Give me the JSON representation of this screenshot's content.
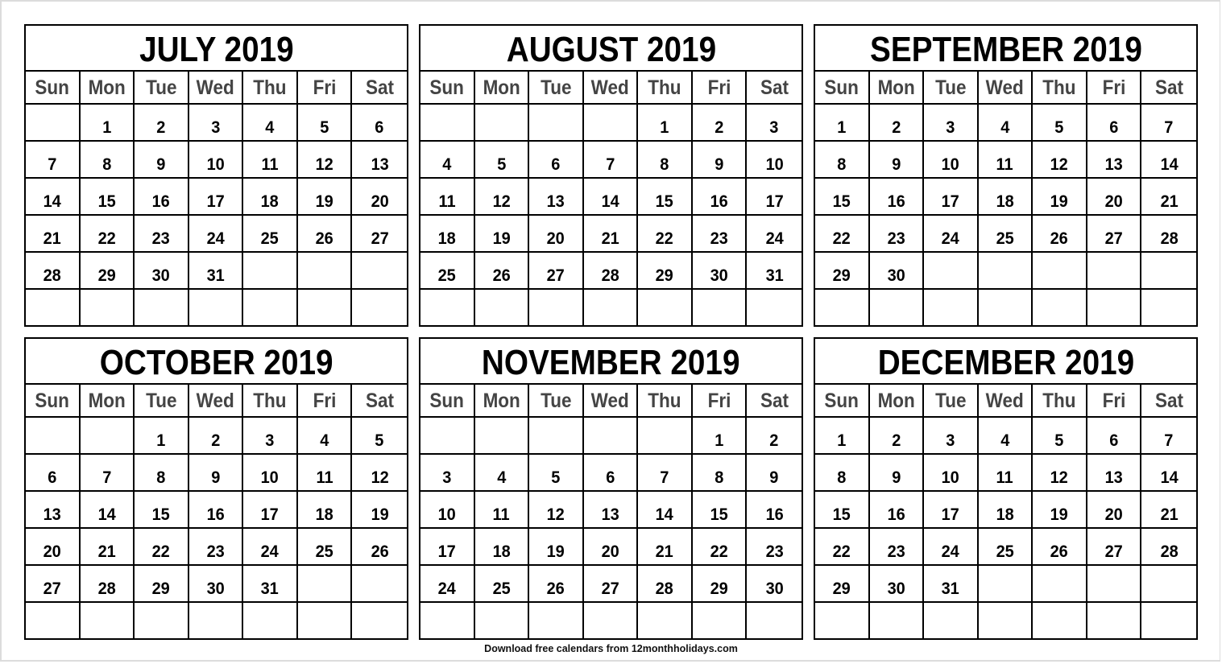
{
  "weekdays": [
    "Sun",
    "Mon",
    "Tue",
    "Wed",
    "Thu",
    "Fri",
    "Sat"
  ],
  "months": [
    {
      "title": "JULY 2019",
      "weeks": [
        [
          "",
          "1",
          "2",
          "3",
          "4",
          "5",
          "6"
        ],
        [
          "7",
          "8",
          "9",
          "10",
          "11",
          "12",
          "13"
        ],
        [
          "14",
          "15",
          "16",
          "17",
          "18",
          "19",
          "20"
        ],
        [
          "21",
          "22",
          "23",
          "24",
          "25",
          "26",
          "27"
        ],
        [
          "28",
          "29",
          "30",
          "31",
          "",
          "",
          ""
        ],
        [
          "",
          "",
          "",
          "",
          "",
          "",
          ""
        ]
      ]
    },
    {
      "title": "AUGUST 2019",
      "weeks": [
        [
          "",
          "",
          "",
          "",
          "1",
          "2",
          "3"
        ],
        [
          "4",
          "5",
          "6",
          "7",
          "8",
          "9",
          "10"
        ],
        [
          "11",
          "12",
          "13",
          "14",
          "15",
          "16",
          "17"
        ],
        [
          "18",
          "19",
          "20",
          "21",
          "22",
          "23",
          "24"
        ],
        [
          "25",
          "26",
          "27",
          "28",
          "29",
          "30",
          "31"
        ],
        [
          "",
          "",
          "",
          "",
          "",
          "",
          ""
        ]
      ]
    },
    {
      "title": "SEPTEMBER 2019",
      "weeks": [
        [
          "1",
          "2",
          "3",
          "4",
          "5",
          "6",
          "7"
        ],
        [
          "8",
          "9",
          "10",
          "11",
          "12",
          "13",
          "14"
        ],
        [
          "15",
          "16",
          "17",
          "18",
          "19",
          "20",
          "21"
        ],
        [
          "22",
          "23",
          "24",
          "25",
          "26",
          "27",
          "28"
        ],
        [
          "29",
          "30",
          "",
          "",
          "",
          "",
          ""
        ],
        [
          "",
          "",
          "",
          "",
          "",
          "",
          ""
        ]
      ]
    },
    {
      "title": "OCTOBER 2019",
      "weeks": [
        [
          "",
          "",
          "1",
          "2",
          "3",
          "4",
          "5"
        ],
        [
          "6",
          "7",
          "8",
          "9",
          "10",
          "11",
          "12"
        ],
        [
          "13",
          "14",
          "15",
          "16",
          "17",
          "18",
          "19"
        ],
        [
          "20",
          "21",
          "22",
          "23",
          "24",
          "25",
          "26"
        ],
        [
          "27",
          "28",
          "29",
          "30",
          "31",
          "",
          ""
        ],
        [
          "",
          "",
          "",
          "",
          "",
          "",
          ""
        ]
      ]
    },
    {
      "title": "NOVEMBER 2019",
      "weeks": [
        [
          "",
          "",
          "",
          "",
          "",
          "1",
          "2"
        ],
        [
          "3",
          "4",
          "5",
          "6",
          "7",
          "8",
          "9"
        ],
        [
          "10",
          "11",
          "12",
          "13",
          "14",
          "15",
          "16"
        ],
        [
          "17",
          "18",
          "19",
          "20",
          "21",
          "22",
          "23"
        ],
        [
          "24",
          "25",
          "26",
          "27",
          "28",
          "29",
          "30"
        ],
        [
          "",
          "",
          "",
          "",
          "",
          "",
          ""
        ]
      ]
    },
    {
      "title": "DECEMBER 2019",
      "weeks": [
        [
          "1",
          "2",
          "3",
          "4",
          "5",
          "6",
          "7"
        ],
        [
          "8",
          "9",
          "10",
          "11",
          "12",
          "13",
          "14"
        ],
        [
          "15",
          "16",
          "17",
          "18",
          "19",
          "20",
          "21"
        ],
        [
          "22",
          "23",
          "24",
          "25",
          "26",
          "27",
          "28"
        ],
        [
          "29",
          "30",
          "31",
          "",
          "",
          "",
          ""
        ],
        [
          "",
          "",
          "",
          "",
          "",
          "",
          ""
        ]
      ]
    }
  ],
  "footer": {
    "text": "Download free calendars from 12monthholidays.com"
  }
}
